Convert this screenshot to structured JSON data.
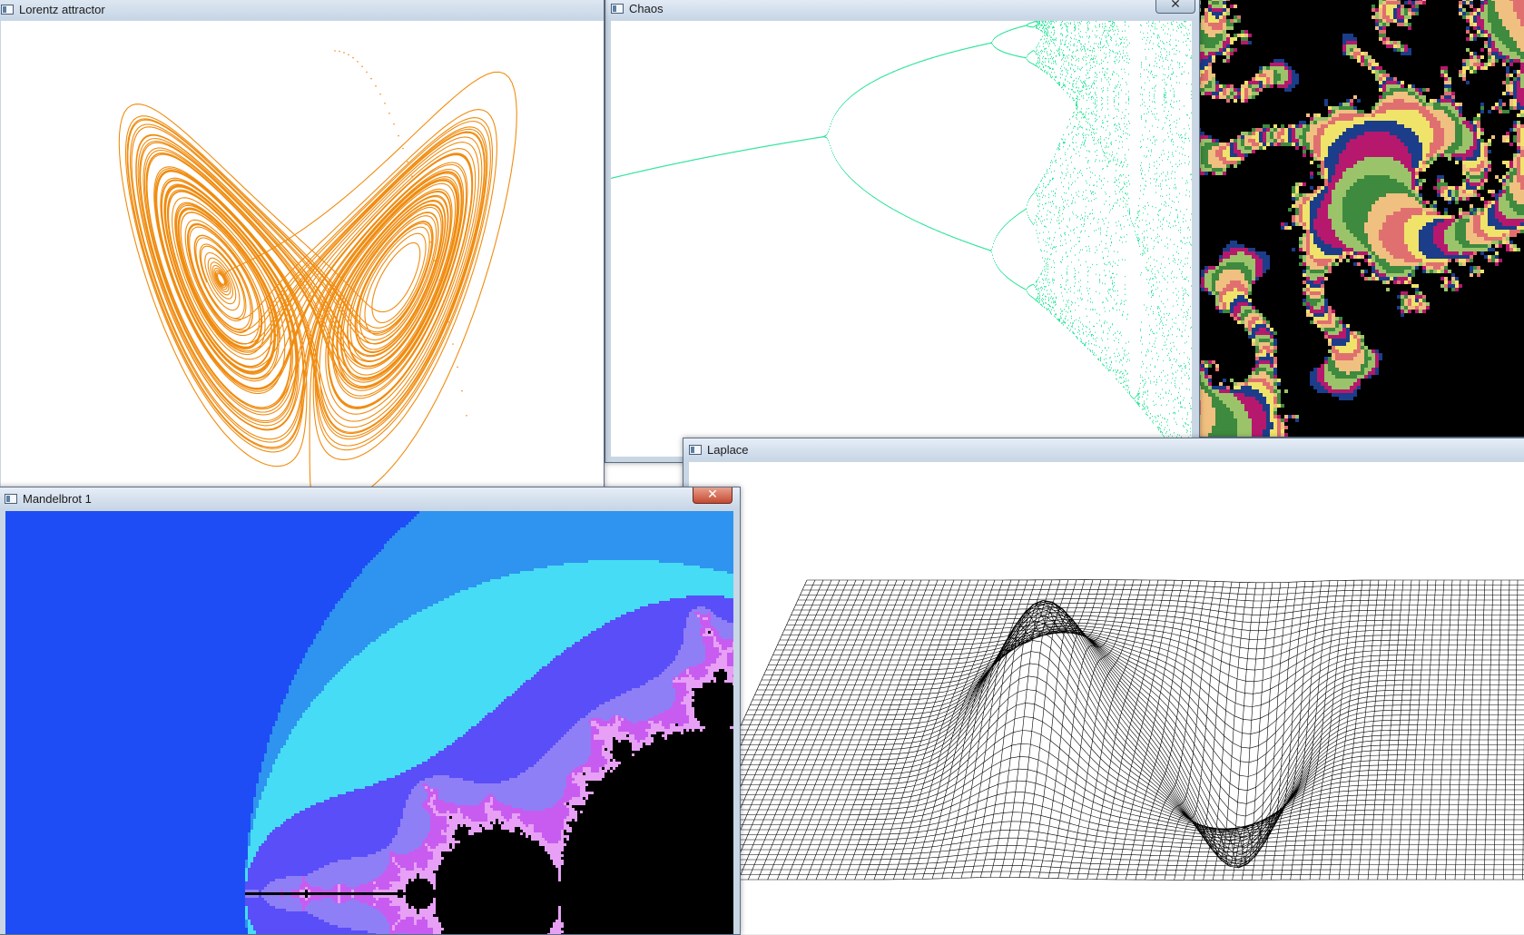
{
  "windows": {
    "lorentz": {
      "title": "Lorentz attractor",
      "curve_color": "#f08c10"
    },
    "chaos": {
      "title": "Chaos",
      "close_label": "✕",
      "point_color": "#2ee59a"
    },
    "laplace": {
      "title": "Laplace",
      "mesh_color": "#000000"
    },
    "mandelbrot": {
      "title": "Mandelbrot 1",
      "close_label": "✕",
      "palette": [
        "#1e4df5",
        "#2f93f0",
        "#46dcf5",
        "#5a4ef8",
        "#8e7ff7",
        "#c85cf0",
        "#e7a0f5",
        "#000000"
      ]
    },
    "fractal": {
      "palette": [
        "#3e8a3e",
        "#9bc46a",
        "#b6186e",
        "#1b3d8a",
        "#f0e36a",
        "#e07070",
        "#f0c080",
        "#000000"
      ]
    }
  }
}
